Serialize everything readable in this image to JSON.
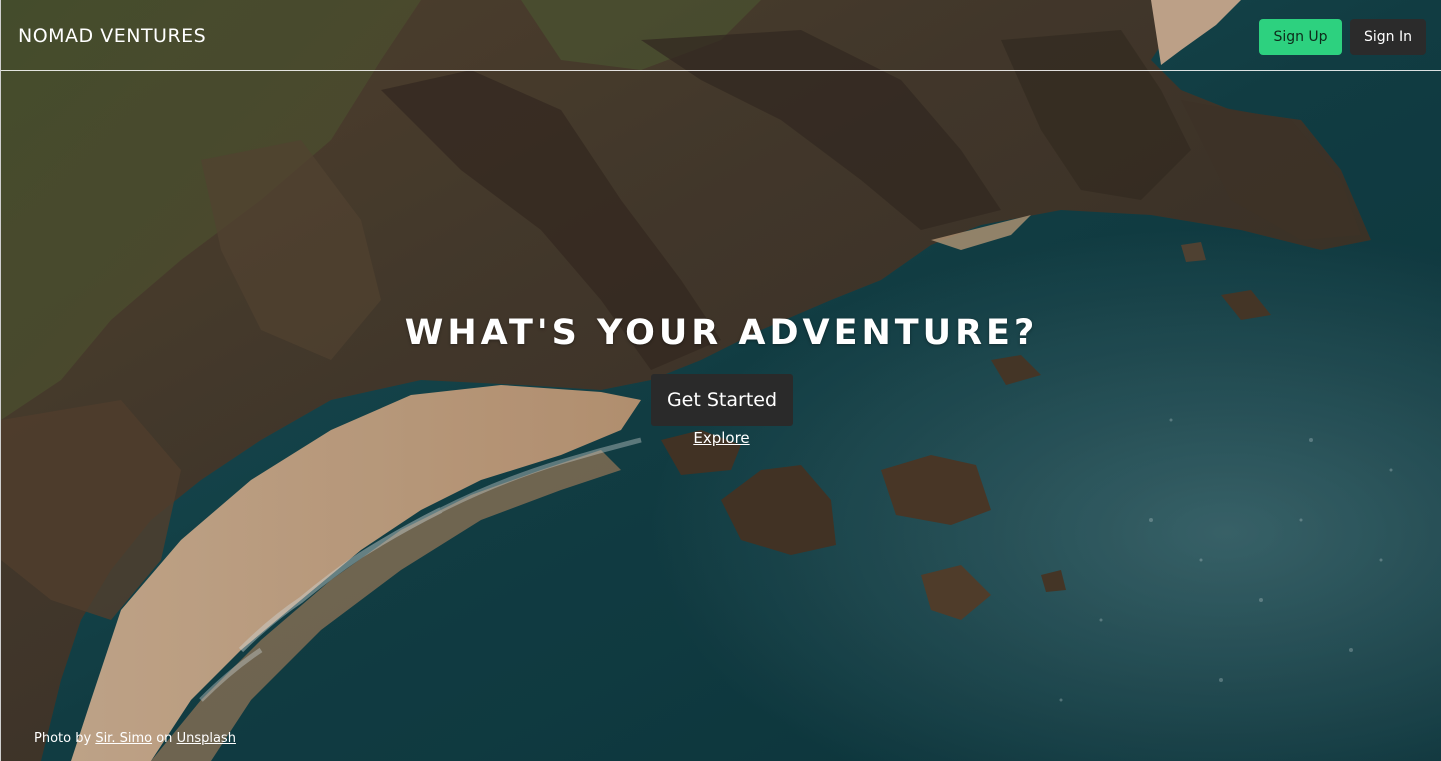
{
  "nav": {
    "brand": "NOMAD VENTURES",
    "signup_label": "Sign Up",
    "signin_label": "Sign In"
  },
  "hero": {
    "title": "WHAT'S YOUR ADVENTURE?",
    "cta_label": "Get Started",
    "explore_label": "Explore"
  },
  "credit": {
    "prefix": "Photo by",
    "author": "Sir. Simo",
    "middle": "on",
    "source": "Unsplash"
  },
  "colors": {
    "signup_bg": "#2dd17f",
    "dark_button_bg": "#2b2b2b",
    "text": "#ffffff"
  }
}
